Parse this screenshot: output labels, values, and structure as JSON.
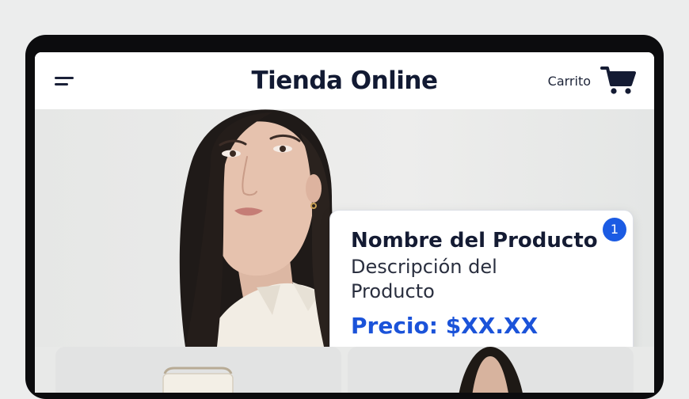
{
  "header": {
    "title": "Tienda Online",
    "cart_label": "Carrito",
    "menu_icon": "hamburger-menu-icon",
    "cart_icon": "shopping-cart-icon"
  },
  "featured_product": {
    "name": "Nombre del Producto",
    "description": "Descripción del Producto",
    "price": "Precio: $XX.XX",
    "badge_count": "1",
    "badge_color": "#1b5be3",
    "price_color": "#1b53d9"
  },
  "colors": {
    "title": "#121a33",
    "accent": "#1b5be3",
    "device_frame": "#0c0c0e"
  }
}
